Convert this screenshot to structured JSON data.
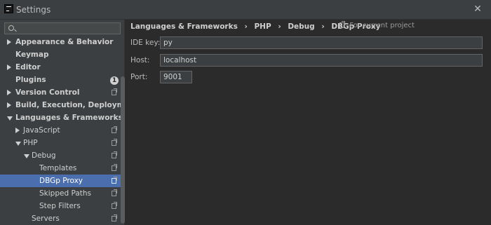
{
  "window": {
    "title": "Settings"
  },
  "sidebar": {
    "search_value": "",
    "items": [
      {
        "label": "Appearance & Behavior"
      },
      {
        "label": "Keymap"
      },
      {
        "label": "Editor"
      },
      {
        "label": "Plugins",
        "badge": "1"
      },
      {
        "label": "Version Control"
      },
      {
        "label": "Build, Execution, Deployment"
      },
      {
        "label": "Languages & Frameworks"
      },
      {
        "label": "JavaScript"
      },
      {
        "label": "PHP"
      },
      {
        "label": "Debug"
      },
      {
        "label": "Templates"
      },
      {
        "label": "DBGp Proxy",
        "selected": true
      },
      {
        "label": "Skipped Paths"
      },
      {
        "label": "Step Filters"
      },
      {
        "label": "Servers"
      }
    ]
  },
  "content": {
    "breadcrumb": [
      "Languages & Frameworks",
      "PHP",
      "Debug",
      "DBGp Proxy"
    ],
    "project_note": "For current project",
    "fields": [
      {
        "label": "IDE key:",
        "value": "py"
      },
      {
        "label": "Host:",
        "value": "localhost"
      },
      {
        "label": "Port:",
        "value": "9001"
      }
    ]
  },
  "colors": {
    "sidebar_bg": "#3c3f41",
    "content_bg": "#2b2b2b",
    "selection": "#4b6eaf"
  }
}
